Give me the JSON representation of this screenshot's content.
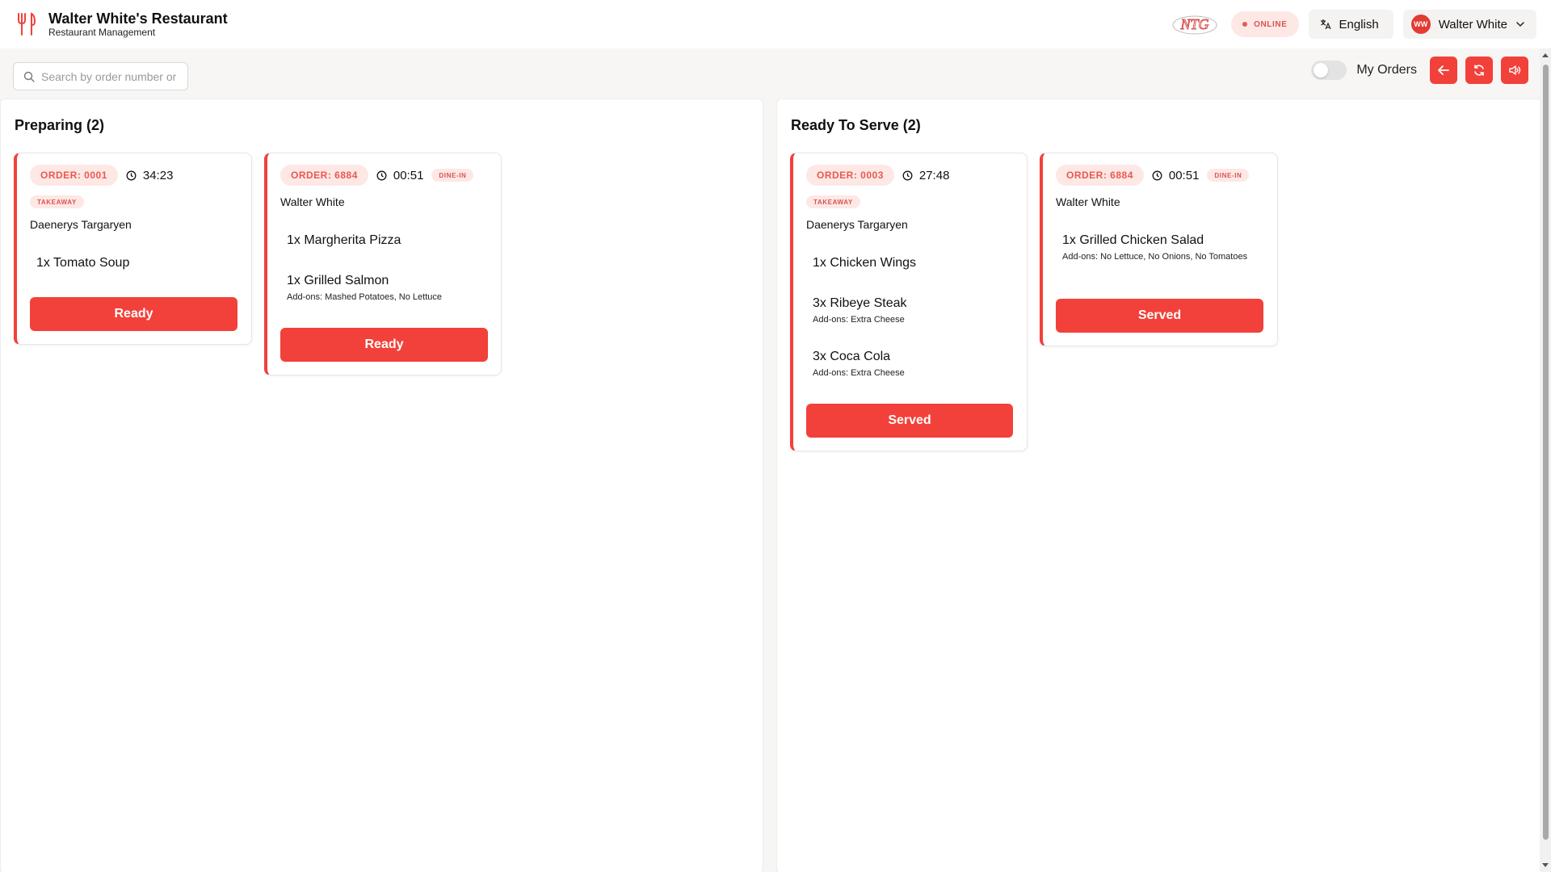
{
  "header": {
    "title": "Walter White's Restaurant",
    "subtitle": "Restaurant Management",
    "partner_logo_text": "NTG",
    "status": "ONLINE",
    "language": "English",
    "user_initials": "WW",
    "user_name": "Walter White"
  },
  "toolbar": {
    "search_placeholder": "Search by order number or customer",
    "my_orders_label": "My Orders",
    "my_orders_enabled": false
  },
  "columns": {
    "preparing": {
      "title": "Preparing (2)",
      "orders": [
        {
          "order": "ORDER: 0001",
          "timer": "34:23",
          "type": "TAKEAWAY",
          "customer": "Daenerys Targaryen",
          "items": [
            {
              "name": "1x Tomato Soup",
              "addons": ""
            }
          ],
          "action": "Ready"
        },
        {
          "order": "ORDER: 6884",
          "timer": "00:51",
          "type": "DINE-IN",
          "customer": "Walter White",
          "items": [
            {
              "name": "1x Margherita Pizza",
              "addons": ""
            },
            {
              "name": "1x Grilled Salmon",
              "addons": "Add-ons: Mashed Potatoes, No Lettuce"
            }
          ],
          "action": "Ready"
        }
      ]
    },
    "ready": {
      "title": "Ready To Serve (2)",
      "orders": [
        {
          "order": "ORDER: 0003",
          "timer": "27:48",
          "type": "TAKEAWAY",
          "customer": "Daenerys Targaryen",
          "items": [
            {
              "name": "1x Chicken Wings",
              "addons": ""
            },
            {
              "name": "3x Ribeye Steak",
              "addons": "Add-ons: Extra Cheese"
            },
            {
              "name": "3x Coca Cola",
              "addons": "Add-ons: Extra Cheese"
            }
          ],
          "action": "Served"
        },
        {
          "order": "ORDER: 6884",
          "timer": "00:51",
          "type": "DINE-IN",
          "customer": "Walter White",
          "items": [
            {
              "name": "1x Grilled Chicken Salad",
              "addons": "Add-ons: No Lettuce, No Onions, No Tomatoes"
            }
          ],
          "action": "Served"
        }
      ]
    }
  },
  "colors": {
    "accent": "#f2413a",
    "pill_bg": "#fde8e6",
    "pill_text": "#e8594f",
    "page_bg": "#f7f6f4"
  }
}
